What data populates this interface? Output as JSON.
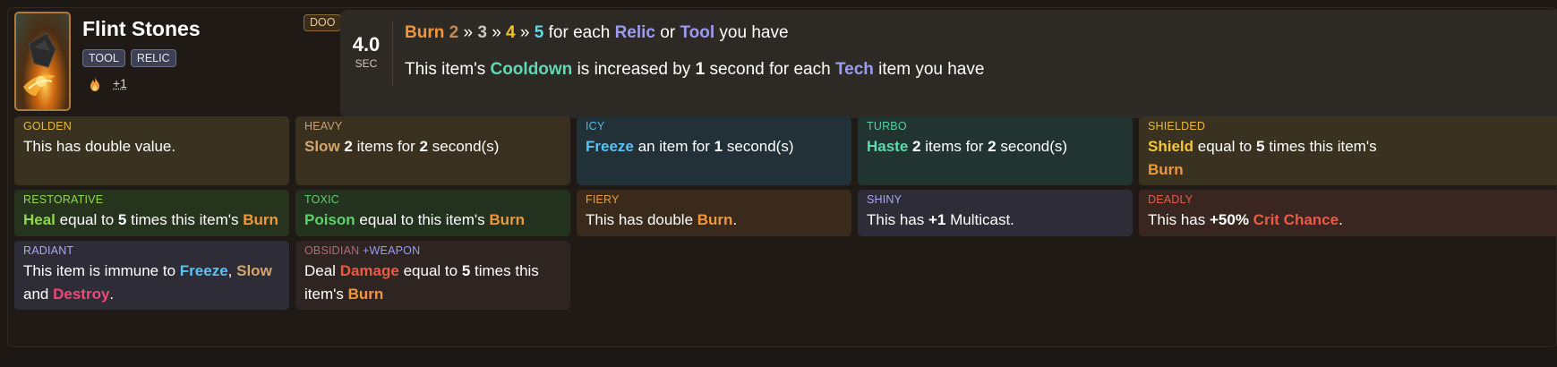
{
  "item": {
    "name": "Flint Stones",
    "tags": [
      "TOOL",
      "RELIC"
    ],
    "rarity_badge": "DOO",
    "stack": "+1",
    "icon": "flame-icon"
  },
  "cooldown": {
    "value": "4.0",
    "unit": "SEC"
  },
  "abilities": {
    "line1": {
      "burn": "Burn",
      "t2": "2",
      "sep1": "»",
      "t3": "3",
      "sep2": "»",
      "t4": "4",
      "sep3": "»",
      "t5": "5",
      "text_a": "for each",
      "relic": "Relic",
      "or": "or",
      "tool": "Tool",
      "text_b": "you have"
    },
    "line2": {
      "text_a": "This item's",
      "cooldown": "Cooldown",
      "text_b": "is increased by",
      "one": "1",
      "text_c": "second for each",
      "tech": "Tech",
      "text_d": "item you have"
    }
  },
  "enchantments": {
    "golden": {
      "title": "GOLDEN",
      "text": "This has double value."
    },
    "heavy": {
      "title": "HEAVY",
      "kw": "Slow",
      "n1": "2",
      "a": "items for",
      "n2": "2",
      "b": "second(s)"
    },
    "icy": {
      "title": "ICY",
      "kw": "Freeze",
      "a": "an item for",
      "n1": "1",
      "b": "second(s)"
    },
    "turbo": {
      "title": "TURBO",
      "kw": "Haste",
      "n1": "2",
      "a": "items for",
      "n2": "2",
      "b": "second(s)"
    },
    "shielded": {
      "title": "SHIELDED",
      "kw": "Shield",
      "a": "equal to",
      "n1": "5",
      "b": "times this item's",
      "burn": "Burn"
    },
    "restorative": {
      "title": "RESTORATIVE",
      "kw": "Heal",
      "a": "equal to",
      "n1": "5",
      "b": "times this item's",
      "burn": "Burn"
    },
    "toxic": {
      "title": "TOXIC",
      "kw": "Poison",
      "a": "equal to this item's",
      "burn": "Burn"
    },
    "fiery": {
      "title": "FIERY",
      "a": "This has double",
      "burn": "Burn",
      "dot": "."
    },
    "shiny": {
      "title": "SHINY",
      "a": "This has",
      "n1": "+1",
      "b": "Multicast."
    },
    "deadly": {
      "title": "DEADLY",
      "a": "This has",
      "n1": "+50%",
      "kw": "Crit Chance",
      "dot": "."
    },
    "radiant": {
      "title": "RADIANT",
      "a": "This item is immune to",
      "freeze": "Freeze",
      "comma": ",",
      "slow": "Slow",
      "and": "and",
      "destroy": "Destroy",
      "dot": "."
    },
    "obsidian": {
      "title": "OBSIDIAN",
      "extra": "+WEAPON",
      "a": "Deal",
      "kw": "Damage",
      "b": "equal to",
      "n1": "5",
      "c": "times this",
      "d": "item's",
      "burn": "Burn"
    }
  },
  "colors": {
    "burn": "#f0973a",
    "tag_keyword": "#9b9bf2",
    "cooldown": "#5fd9b2",
    "freeze": "#58c3f4",
    "slow": "#d4a66f",
    "shield": "#f5c53a",
    "heal": "#8ed84a",
    "poison": "#5ed16a",
    "crit": "#ec5a45",
    "destroy": "#ec4a78"
  }
}
